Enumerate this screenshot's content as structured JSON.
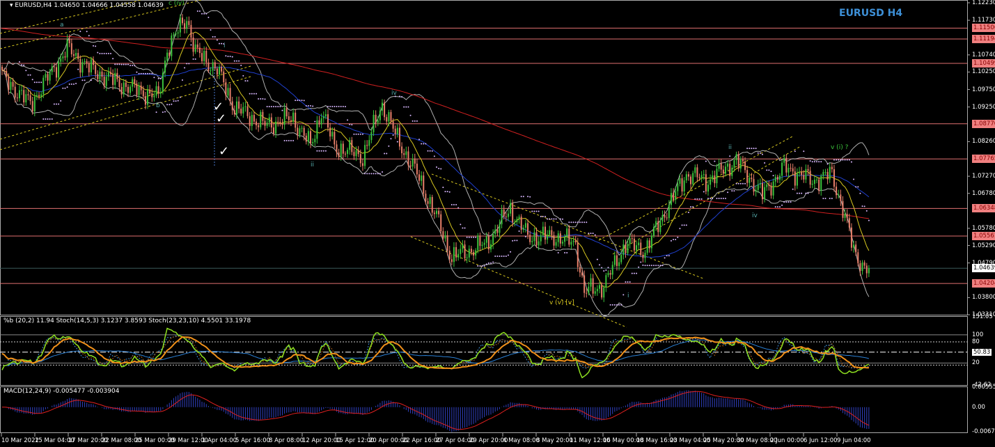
{
  "header": {
    "symbol_info": "EURUSD,H4  1.04650 1.04666 1.04558 1.04639",
    "watermark": "EURUSD H4"
  },
  "price_axis": {
    "ticks": [
      "1.12230",
      "1.11730",
      "1.10740",
      "1.10250",
      "1.09750",
      "1.09250",
      "1.08260",
      "1.07270",
      "1.06780",
      "1.05780",
      "1.05290",
      "1.04790",
      "1.03800",
      "1.03310"
    ],
    "levels": [
      "1.11506",
      "1.11194",
      "1.10499",
      "1.08770",
      "1.07765",
      "1.06348",
      "1.05561",
      "1.04204"
    ],
    "current": "1.04639",
    "range": [
      1.0331,
      1.1223
    ]
  },
  "oscillator": {
    "label": "%b (20,2) 11.94  Stoch(14,5,3) 3.1237 3.8593  Stoch(23,23,10) 4.5501 33.1978",
    "ticks": [
      "151.05",
      "80",
      "100",
      "50.83",
      "20",
      "-42.62"
    ],
    "range": [
      -42.62,
      151.05
    ]
  },
  "macd": {
    "label": "MACD(12,24,9) -0.005477 -0.003904",
    "ticks": [
      "0.005556",
      "0.00",
      "-0.006798"
    ],
    "range": [
      -0.006798,
      0.005556
    ]
  },
  "time_axis": [
    "10 Mar 2022",
    "15 Mar 04:00",
    "17 Mar 20:00",
    "22 Mar 08:00",
    "25 Mar 00:00",
    "29 Mar 12:00",
    "1 Apr 04:00",
    "5 Apr 16:00",
    "8 Apr 08:00",
    "12 Apr 20:00",
    "15 Apr 12:00",
    "20 Apr 00:00",
    "22 Apr 16:00",
    "27 Apr 04:00",
    "29 Apr 20:00",
    "4 May 08:00",
    "8 May 20:00",
    "11 May 12:00",
    "16 May 00:00",
    "18 May 16:00",
    "23 May 04:00",
    "25 May 20:00",
    "30 May 08:00",
    "2 Jun 00:00",
    "6 Jun 12:00",
    "9 Jun 04:00"
  ],
  "waves": [
    {
      "t": "c (iv)"
    },
    {
      "t": "a"
    },
    {
      "t": "b"
    },
    {
      "t": "i"
    },
    {
      "t": "ii"
    },
    {
      "t": "iv"
    },
    {
      "t": "v (v) [v]"
    },
    {
      "t": "i"
    },
    {
      "t": "ii"
    },
    {
      "t": "iv"
    },
    {
      "t": "v (i) ?"
    }
  ],
  "checkmarks": [
    "✓",
    "✓",
    "✓"
  ],
  "colors": {
    "up": "#3cc43c",
    "down": "#e8806a",
    "ma_red": "#d02020",
    "ma_blue": "#2040d0",
    "ma_yellow": "#d8c820",
    "bands": "#b0b0b0",
    "level": "#e07070"
  },
  "chart_data": {
    "type": "candlestick",
    "symbol": "EURUSD",
    "timeframe": "H4",
    "bars": 400,
    "keypoints": [
      [
        0,
        1.1012
      ],
      [
        13,
        1.0933
      ],
      [
        30,
        1.1092
      ],
      [
        41,
        1.1032
      ],
      [
        54,
        1.0992
      ],
      [
        72,
        1.0952
      ],
      [
        76,
        1.1092
      ],
      [
        85,
        1.1181
      ],
      [
        89,
        1.1082
      ],
      [
        99,
        1.1032
      ],
      [
        107,
        1.0923
      ],
      [
        121,
        1.0873
      ],
      [
        134,
        1.0893
      ],
      [
        142,
        1.0813
      ],
      [
        147,
        1.0913
      ],
      [
        153,
        1.0813
      ],
      [
        166,
        1.0783
      ],
      [
        175,
        1.0933
      ],
      [
        182,
        1.0833
      ],
      [
        191,
        1.0733
      ],
      [
        201,
        1.0594
      ],
      [
        207,
        1.0495
      ],
      [
        223,
        1.0534
      ],
      [
        234,
        1.0634
      ],
      [
        242,
        1.0554
      ],
      [
        255,
        1.0554
      ],
      [
        264,
        1.0534
      ],
      [
        268,
        1.0395
      ],
      [
        277,
        1.0415
      ],
      [
        287,
        1.0534
      ],
      [
        296,
        1.0515
      ],
      [
        306,
        1.0634
      ],
      [
        315,
        1.0733
      ],
      [
        325,
        1.0714
      ],
      [
        338,
        1.0773
      ],
      [
        350,
        1.0674
      ],
      [
        360,
        1.0753
      ],
      [
        373,
        1.0714
      ],
      [
        382,
        1.0733
      ],
      [
        387,
        1.0634
      ],
      [
        392,
        1.0515
      ],
      [
        397,
        1.04639
      ]
    ]
  }
}
